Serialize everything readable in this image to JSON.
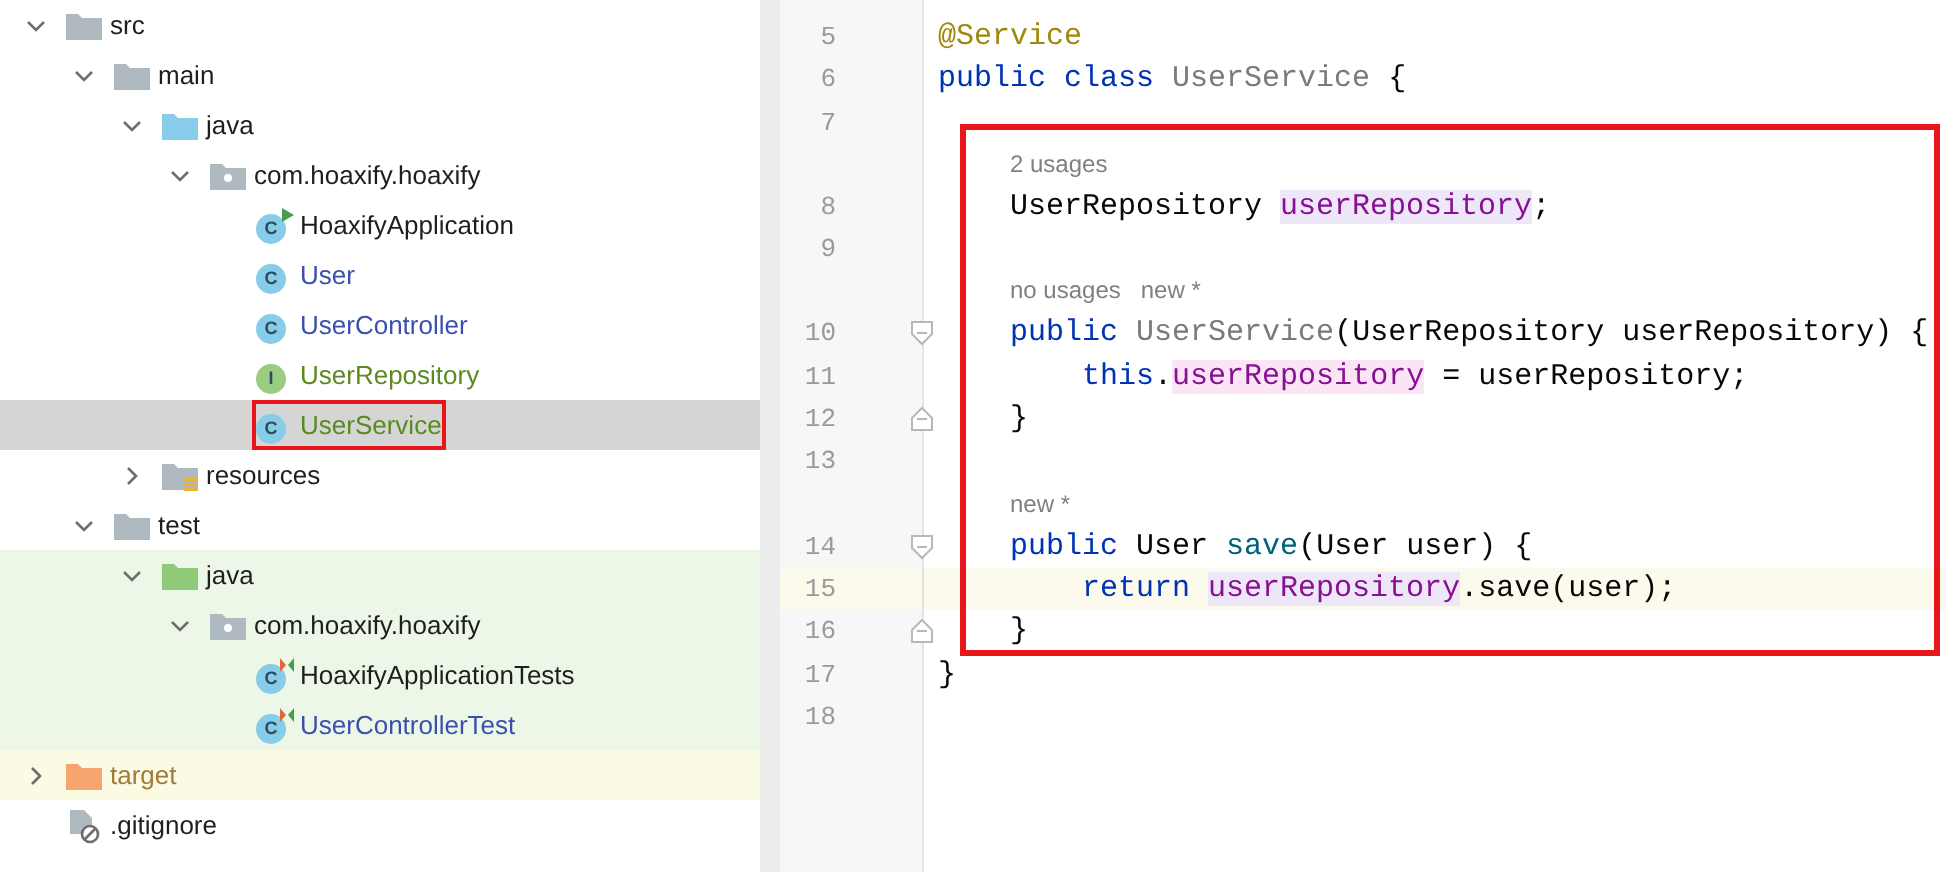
{
  "project_tree": {
    "items": [
      {
        "label": "src",
        "kind": "folder",
        "expanded": true,
        "selected": false,
        "children": [
          {
            "label": "main",
            "kind": "folder",
            "expanded": true,
            "selected": false,
            "children": [
              {
                "label": "java",
                "kind": "source-root",
                "expanded": true,
                "selected": false,
                "children": [
                  {
                    "label": "com.hoaxify.hoaxify",
                    "kind": "package",
                    "expanded": true,
                    "selected": false,
                    "children": [
                      {
                        "label": "HoaxifyApplication",
                        "kind": "main-class",
                        "icon_text": "C",
                        "selected": false
                      },
                      {
                        "label": "User",
                        "kind": "class",
                        "icon_text": "C",
                        "color": "#3a4fb0",
                        "selected": false
                      },
                      {
                        "label": "UserController",
                        "kind": "class",
                        "icon_text": "C",
                        "color": "#3a4fb0",
                        "selected": false
                      },
                      {
                        "label": "UserRepository",
                        "kind": "interface",
                        "icon_text": "I",
                        "color": "#5b8a1e",
                        "selected": false
                      },
                      {
                        "label": "UserService",
                        "kind": "class",
                        "icon_text": "C",
                        "color": "#5b8a1e",
                        "selected": true,
                        "highlighted": true
                      }
                    ]
                  }
                ]
              },
              {
                "label": "resources",
                "kind": "resources-root",
                "expanded": false,
                "selected": false
              }
            ]
          },
          {
            "label": "test",
            "kind": "folder",
            "expanded": true,
            "selected": false,
            "children": [
              {
                "label": "java",
                "kind": "test-root",
                "expanded": true,
                "selected": false,
                "children": [
                  {
                    "label": "com.hoaxify.hoaxify",
                    "kind": "package",
                    "expanded": true,
                    "selected": false,
                    "children": [
                      {
                        "label": "HoaxifyApplicationTests",
                        "kind": "test-class",
                        "icon_text": "C",
                        "selected": false
                      },
                      {
                        "label": "UserControllerTest",
                        "kind": "test-class",
                        "icon_text": "C",
                        "color": "#3a4fb0",
                        "selected": false
                      }
                    ]
                  }
                ]
              }
            ]
          }
        ]
      },
      {
        "label": "target",
        "kind": "excluded-folder",
        "color": "#a07a3a",
        "expanded": false,
        "selected": false
      },
      {
        "label": ".gitignore",
        "kind": "ignore-file",
        "selected": false
      }
    ]
  },
  "editor": {
    "lines": [
      {
        "number": "5",
        "tokens": [
          {
            "text": "@Service",
            "kind": "annotation"
          }
        ]
      },
      {
        "number": "6",
        "tokens": [
          {
            "text": "public class ",
            "kind": "keyword"
          },
          {
            "text": "UserService",
            "kind": "unused"
          },
          {
            "text": " {",
            "kind": "plain"
          }
        ]
      },
      {
        "number": "7"
      },
      {
        "number": "8",
        "hint": "2 usages",
        "tokens": [
          {
            "text": "    UserRepository ",
            "kind": "plain"
          },
          {
            "text": "userRepository",
            "kind": "field-read"
          },
          {
            "text": ";",
            "kind": "plain"
          }
        ]
      },
      {
        "number": "9"
      },
      {
        "number": "10",
        "hint": "no usages   new *",
        "fold_start": true,
        "tokens": [
          {
            "text": "    public ",
            "kind": "keyword"
          },
          {
            "text": "UserService",
            "kind": "unused"
          },
          {
            "text": "(UserRepository userRepository) {",
            "kind": "plain"
          }
        ]
      },
      {
        "number": "11",
        "tokens": [
          {
            "text": "        this",
            "kind": "keyword"
          },
          {
            "text": ".",
            "kind": "plain"
          },
          {
            "text": "userRepository",
            "kind": "field-write"
          },
          {
            "text": " = userRepository;",
            "kind": "plain"
          }
        ]
      },
      {
        "number": "12",
        "fold_start": false,
        "tokens": [
          {
            "text": "    }",
            "kind": "plain"
          }
        ]
      },
      {
        "number": "13"
      },
      {
        "number": "14",
        "hint": "new *",
        "fold_start": true,
        "tokens": [
          {
            "text": "    public ",
            "kind": "keyword"
          },
          {
            "text": "User ",
            "kind": "plain"
          },
          {
            "text": "save",
            "kind": "method"
          },
          {
            "text": "(User user) {",
            "kind": "plain"
          }
        ]
      },
      {
        "number": "15",
        "current": true,
        "tokens": [
          {
            "text": "        return ",
            "kind": "keyword"
          },
          {
            "text": "userRepository",
            "kind": "field-read"
          },
          {
            "text": ".save(user);",
            "kind": "plain"
          }
        ]
      },
      {
        "number": "16",
        "fold_start": false,
        "tokens": [
          {
            "text": "    }",
            "kind": "plain"
          }
        ]
      },
      {
        "number": "17",
        "tokens": [
          {
            "text": "}",
            "kind": "plain"
          }
        ]
      },
      {
        "number": "18"
      }
    ]
  }
}
